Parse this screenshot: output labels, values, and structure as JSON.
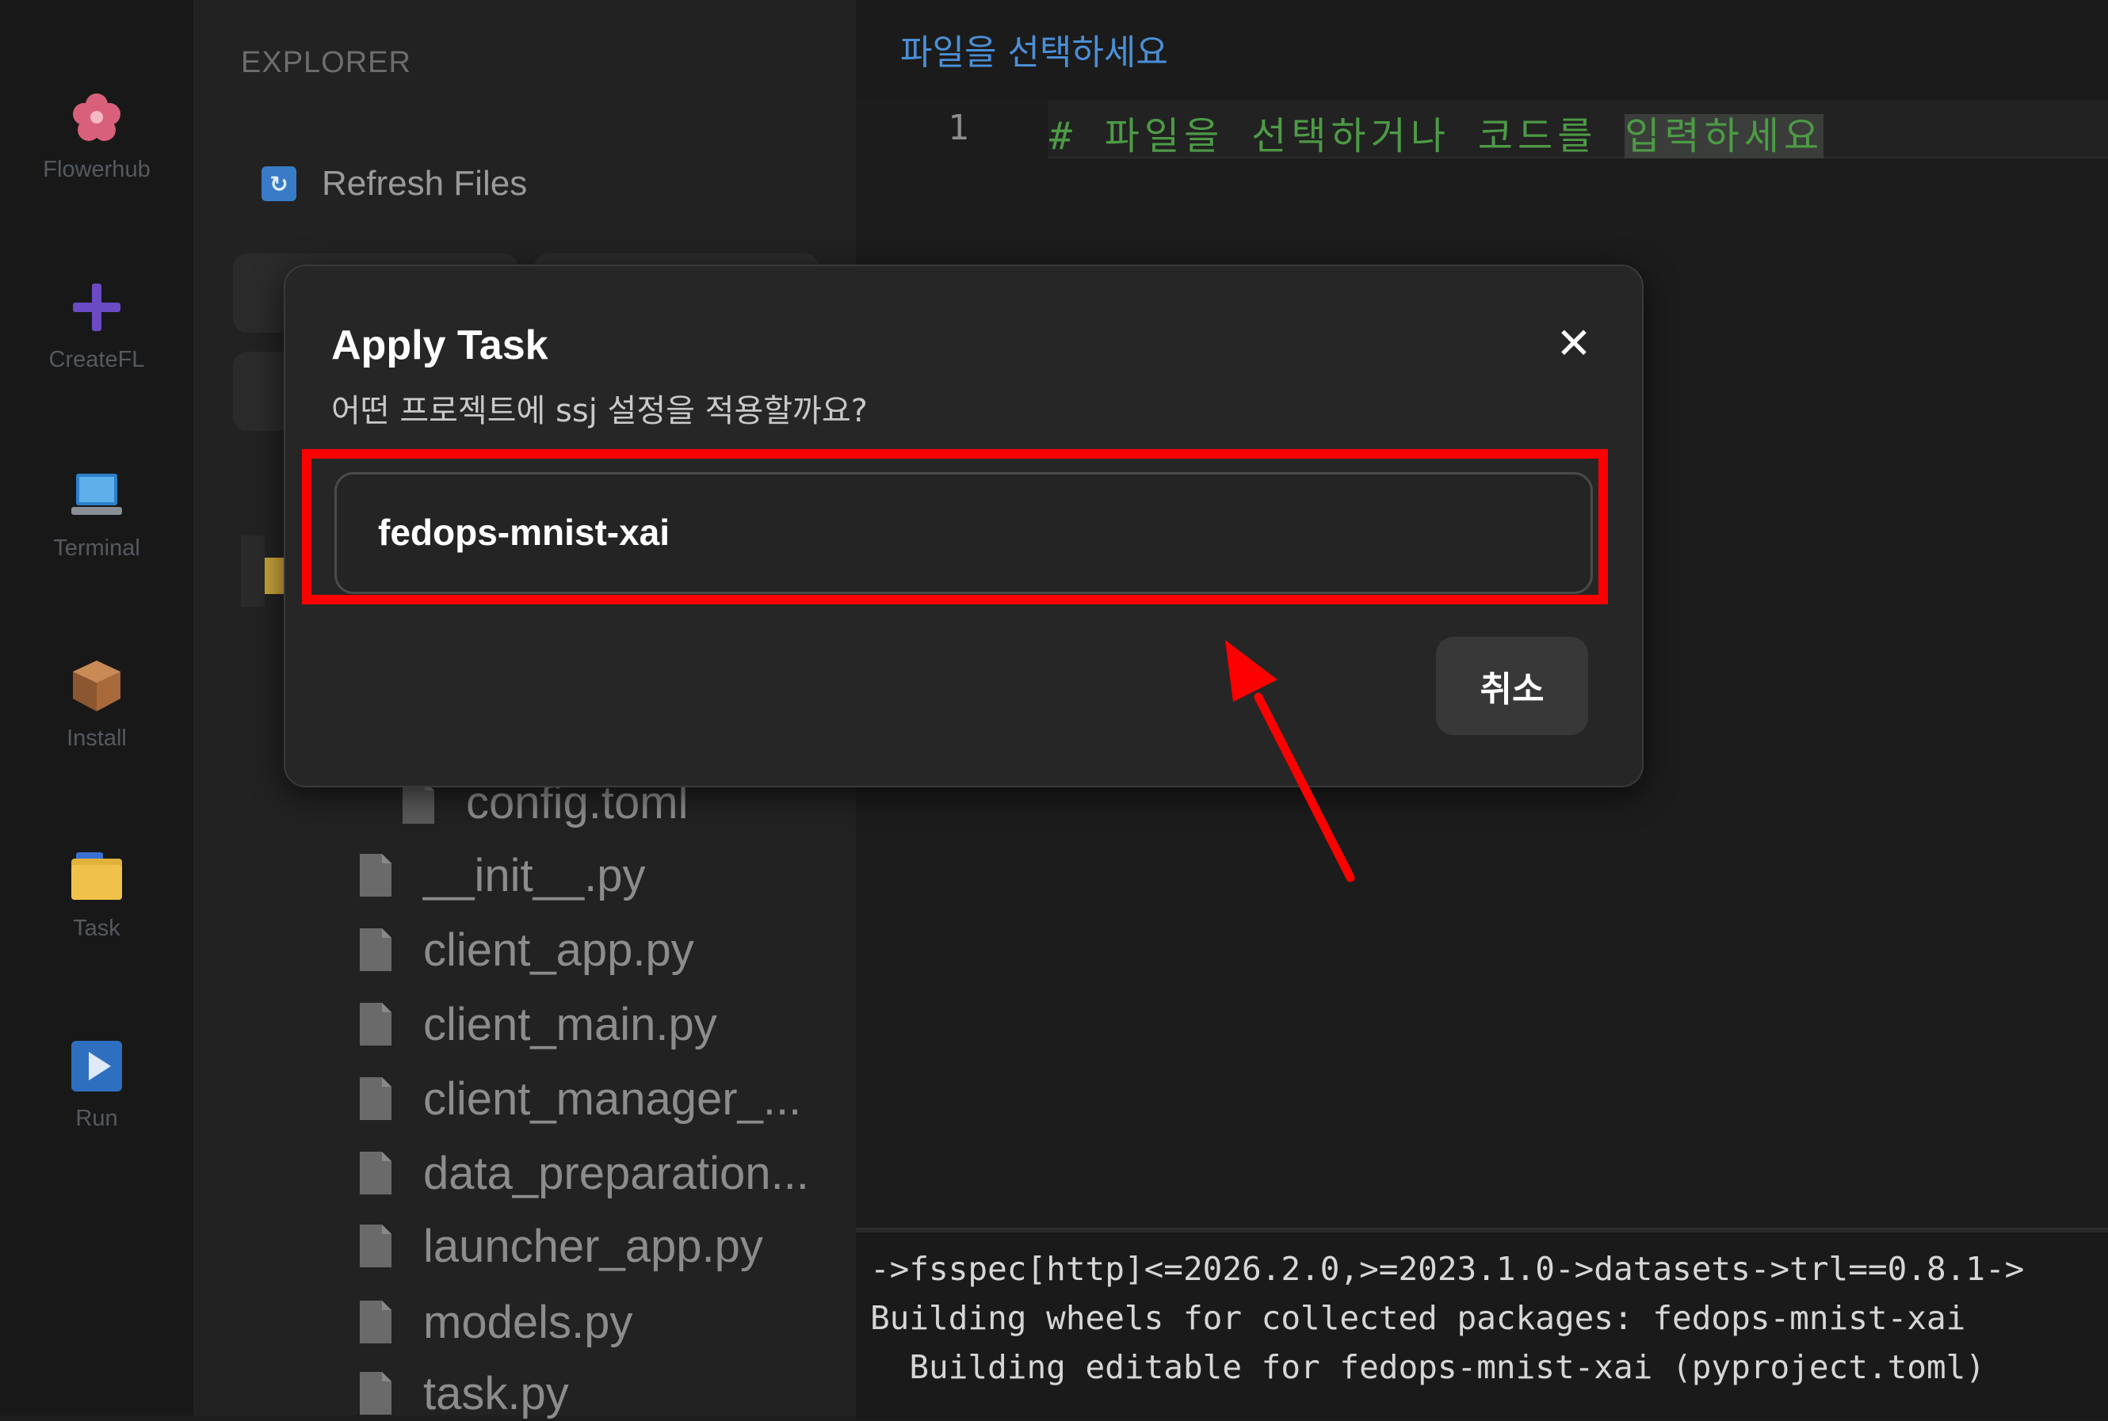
{
  "activity_bar": {
    "items": [
      {
        "label": "Flowerhub",
        "icon": "flower-icon"
      },
      {
        "label": "CreateFL",
        "icon": "plus-icon"
      },
      {
        "label": "Terminal",
        "icon": "laptop-icon"
      },
      {
        "label": "Install",
        "icon": "package-icon"
      },
      {
        "label": "Task",
        "icon": "folder-icon"
      },
      {
        "label": "Run",
        "icon": "play-icon"
      }
    ]
  },
  "explorer": {
    "title": "EXPLORER",
    "refresh_label": "Refresh Files",
    "files": [
      "config.toml",
      "__init__.py",
      "client_app.py",
      "client_main.py",
      "client_manager_...",
      "data_preparation...",
      "launcher_app.py",
      "models.py",
      "task.py"
    ]
  },
  "editor": {
    "tab_title": "파일을 선택하세요",
    "line_number": "1",
    "code_text": "# 파일을 선택하거나 코드를 ",
    "code_text_selected": "입력하세요"
  },
  "terminal": {
    "lines": [
      "->fsspec[http]<=2026.2.0,>=2023.1.0->datasets->trl==0.8.1->",
      "Building wheels for collected packages: fedops-mnist-xai",
      "  Building editable for fedops-mnist-xai (pyproject.toml)"
    ]
  },
  "modal": {
    "title": "Apply Task",
    "close_symbol": "✕",
    "subtitle": "어떤 프로젝트에 ssj 설정을 적용할까요?",
    "project_option": "fedops-mnist-xai",
    "cancel_label": "취소"
  },
  "colors": {
    "annotation": "#ff0000",
    "code_comment": "#4d9a46",
    "tab_title": "#4b8fd6"
  }
}
